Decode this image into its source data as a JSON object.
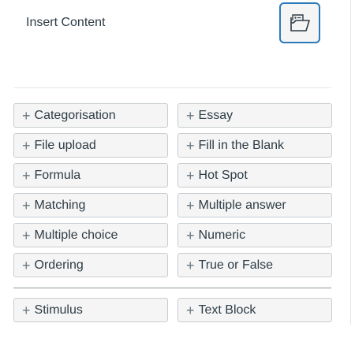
{
  "header": {
    "title": "Insert Content"
  },
  "question_types": [
    {
      "label": "Categorisation",
      "icon": "plus-icon"
    },
    {
      "label": "Essay",
      "icon": "plus-icon"
    },
    {
      "label": "File upload",
      "icon": "plus-icon"
    },
    {
      "label": "Fill in the Blank",
      "icon": "plus-icon"
    },
    {
      "label": "Formula",
      "icon": "plus-icon"
    },
    {
      "label": "Hot Spot",
      "icon": "plus-icon"
    },
    {
      "label": "Matching",
      "icon": "plus-icon"
    },
    {
      "label": "Multiple answer",
      "icon": "plus-icon"
    },
    {
      "label": "Multiple choice",
      "icon": "plus-icon"
    },
    {
      "label": "Numeric",
      "icon": "plus-icon"
    },
    {
      "label": "Ordering",
      "icon": "plus-icon"
    },
    {
      "label": "True or False",
      "icon": "plus-icon"
    }
  ],
  "content_blocks": [
    {
      "label": "Stimulus",
      "icon": "plus-icon"
    },
    {
      "label": "Text Block",
      "icon": "plus-icon"
    }
  ],
  "plus_glyph": "+",
  "colors": {
    "accent": "#2b7abc",
    "text": "#2d3b45",
    "button_bg": "#f5f5f5",
    "button_border": "#c7cdd1"
  }
}
